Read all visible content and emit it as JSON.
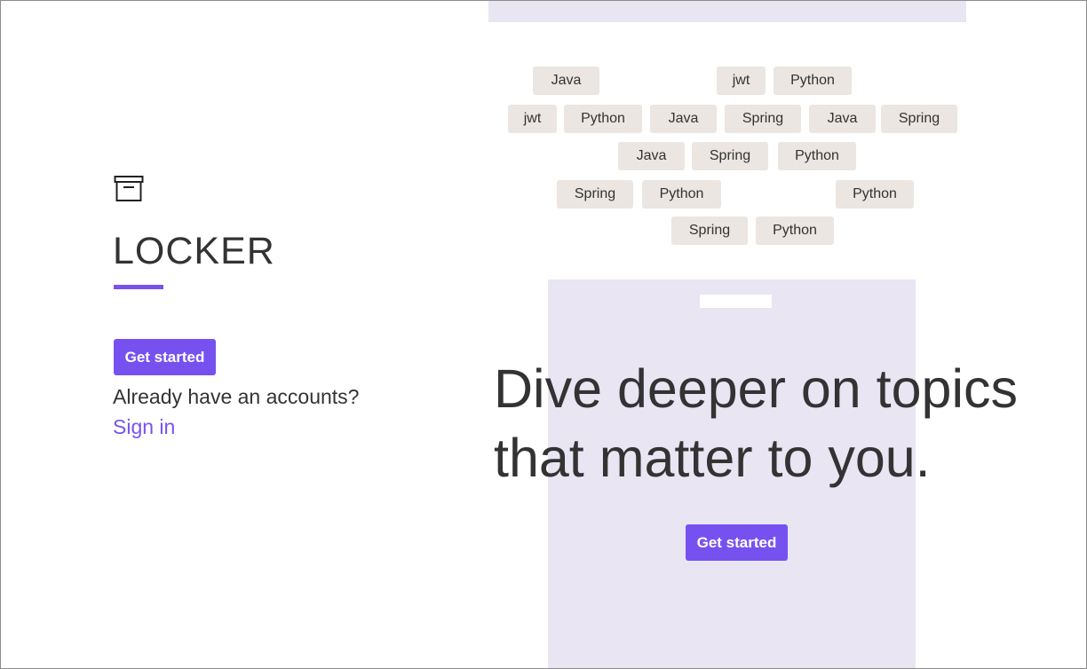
{
  "left": {
    "brand_name": "LOCKER",
    "get_started_label": "Get started",
    "already_text": "Already have an accounts?",
    "sign_in_label": "Sign in",
    "logo_icon": "archive-box-icon"
  },
  "tags": [
    "Java",
    "jwt",
    "Python",
    "jwt",
    "Python",
    "Java",
    "Spring",
    "Java",
    "Spring",
    "Java",
    "Spring",
    "Python",
    "Spring",
    "Python",
    "Python",
    "Spring",
    "Python"
  ],
  "hero": {
    "headline": "Dive deeper on topics that matter to you.",
    "cta_label": "Get started"
  },
  "colors": {
    "accent": "#7751f0",
    "tag_bg": "#ebe6e1",
    "hero_bg": "#e9e5f3",
    "text": "#333333"
  }
}
